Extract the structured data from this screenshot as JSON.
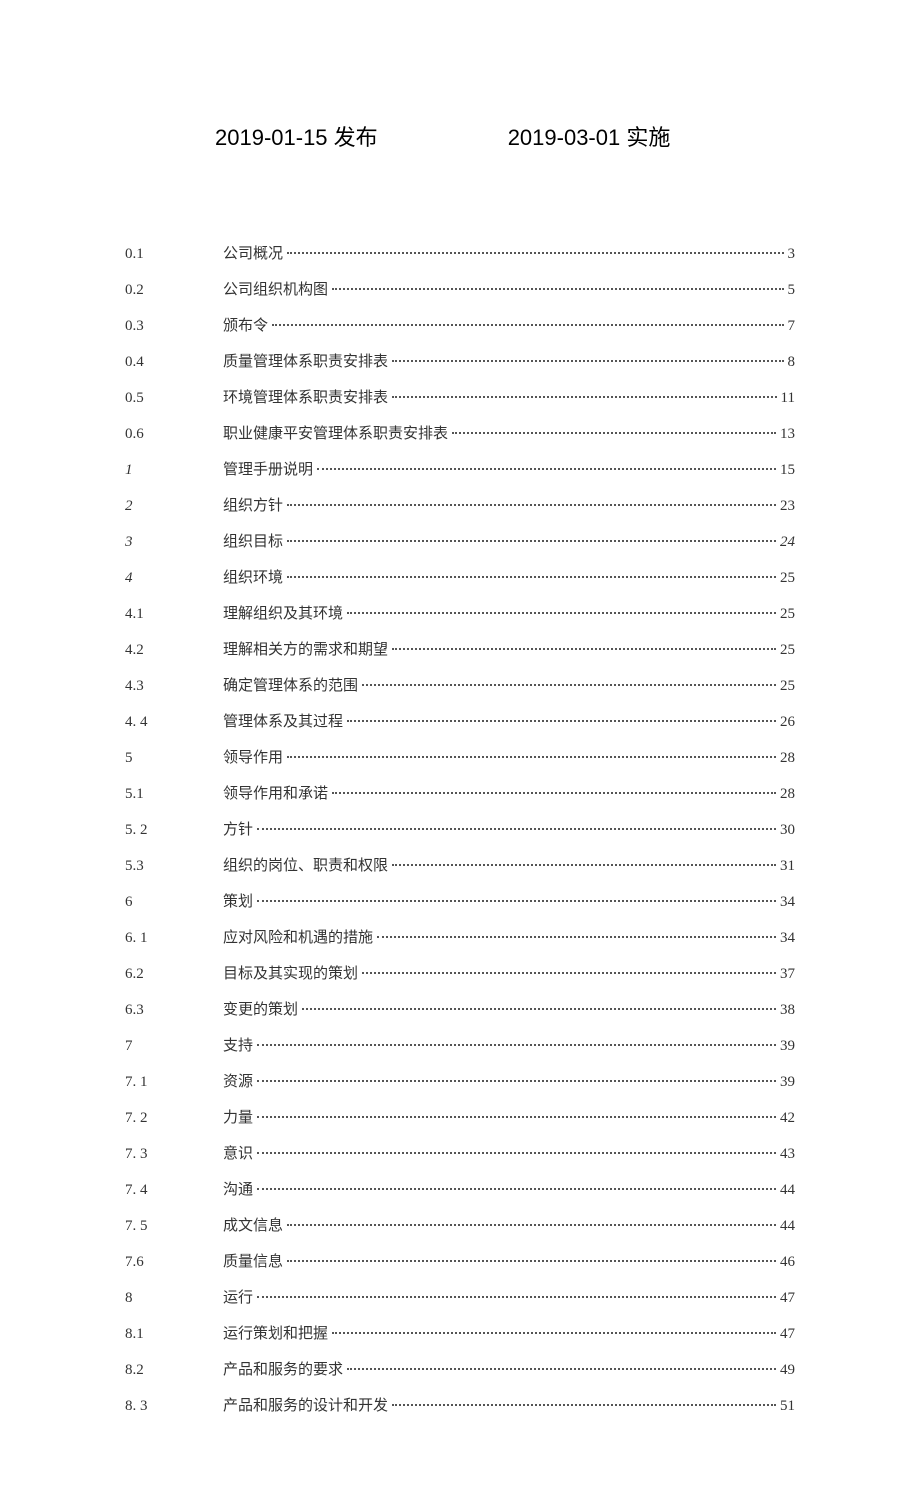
{
  "header": {
    "publish_date": "2019-01-15",
    "publish_label": "发布",
    "effective_date": "2019-03-01",
    "effective_label": "实施"
  },
  "toc": [
    {
      "num": "0.1",
      "title": "公司概况",
      "page": "3",
      "num_italic": false,
      "page_italic": false
    },
    {
      "num": "0.2",
      "title": "公司组织机构图",
      "page": "5",
      "num_italic": false,
      "page_italic": false
    },
    {
      "num": "0.3",
      "title": "颁布令",
      "page": "7",
      "num_italic": false,
      "page_italic": false
    },
    {
      "num": "0.4",
      "title": "质量管理体系职责安排表",
      "page": "8",
      "num_italic": false,
      "page_italic": false
    },
    {
      "num": "0.5",
      "title": "环境管理体系职责安排表",
      "page": "11",
      "num_italic": false,
      "page_italic": false
    },
    {
      "num": "0.6",
      "title": "职业健康平安管理体系职责安排表",
      "page": "13",
      "num_italic": false,
      "page_italic": false
    },
    {
      "num": "1",
      "title": "管理手册说明",
      "page": "15",
      "num_italic": true,
      "page_italic": false
    },
    {
      "num": "2",
      "title": "组织方针",
      "page": "23",
      "num_italic": true,
      "page_italic": false
    },
    {
      "num": "3",
      "title": "组织目标",
      "page": "24",
      "num_italic": true,
      "page_italic": true
    },
    {
      "num": "4",
      "title": "组织环境",
      "page": "25",
      "num_italic": true,
      "page_italic": false
    },
    {
      "num": "4.1",
      "title": "理解组织及其环境",
      "page": "25",
      "num_italic": false,
      "page_italic": false
    },
    {
      "num": "4.2",
      "title": "理解相关方的需求和期望",
      "page": "25",
      "num_italic": false,
      "page_italic": false
    },
    {
      "num": "4.3",
      "title": "确定管理体系的范围",
      "page": "25",
      "num_italic": false,
      "page_italic": false
    },
    {
      "num": "4.  4",
      "title": "管理体系及其过程",
      "page": "26",
      "num_italic": false,
      "page_italic": false
    },
    {
      "num": "5",
      "title": "领导作用",
      "page": "28",
      "num_italic": false,
      "page_italic": false
    },
    {
      "num": "5.1",
      "title": "领导作用和承诺",
      "page": "28",
      "num_italic": false,
      "page_italic": false
    },
    {
      "num": "5.  2",
      "title": "方针",
      "page": "30",
      "num_italic": false,
      "page_italic": false
    },
    {
      "num": "5.3",
      "title": "组织的岗位、职责和权限",
      "page": "31",
      "num_italic": false,
      "page_italic": false
    },
    {
      "num": "6",
      "title": "策划",
      "page": "34",
      "num_italic": false,
      "page_italic": false
    },
    {
      "num": "6.  1",
      "title": "应对风险和机遇的措施",
      "page": "34",
      "num_italic": false,
      "page_italic": false
    },
    {
      "num": "6.2",
      "title": "目标及其实现的策划",
      "page": "37",
      "num_italic": false,
      "page_italic": false
    },
    {
      "num": "6.3",
      "title": "变更的策划",
      "page": "38",
      "num_italic": false,
      "page_italic": false
    },
    {
      "num": "7",
      "title": "支持",
      "page": "39",
      "num_italic": false,
      "page_italic": false
    },
    {
      "num": "7.  1",
      "title": "资源",
      "page": "39",
      "num_italic": false,
      "page_italic": false
    },
    {
      "num": "7.  2",
      "title": "力量",
      "page": "42",
      "num_italic": false,
      "page_italic": false
    },
    {
      "num": "7.  3",
      "title": "意识",
      "page": "43",
      "num_italic": false,
      "page_italic": false
    },
    {
      "num": "7.  4",
      "title": "沟通",
      "page": "44",
      "num_italic": false,
      "page_italic": false
    },
    {
      "num": "7.  5",
      "title": "成文信息",
      "page": "44",
      "num_italic": false,
      "page_italic": false
    },
    {
      "num": "7.6",
      "title": "质量信息",
      "page": "46",
      "num_italic": false,
      "page_italic": false
    },
    {
      "num": "8",
      "title": "运行",
      "page": "47",
      "num_italic": false,
      "page_italic": false
    },
    {
      "num": "8.1",
      "title": "运行策划和把握",
      "page": "47",
      "num_italic": false,
      "page_italic": false
    },
    {
      "num": "8.2",
      "title": "产品和服务的要求",
      "page": "49",
      "num_italic": false,
      "page_italic": false
    },
    {
      "num": "8.  3",
      "title": "产品和服务的设计和开发",
      "page": "51",
      "num_italic": false,
      "page_italic": false
    }
  ]
}
